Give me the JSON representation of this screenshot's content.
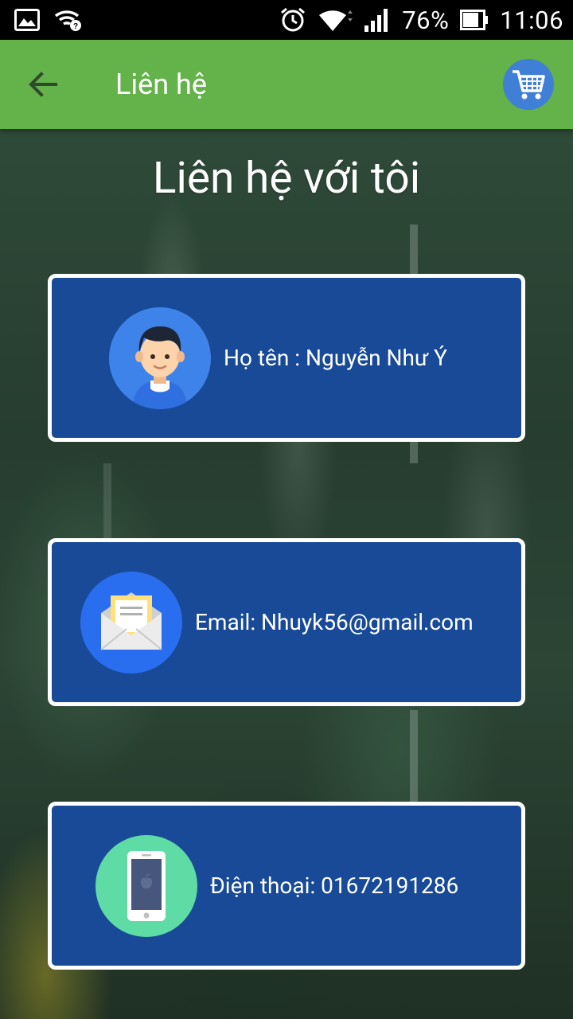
{
  "status_bar": {
    "battery": "76%",
    "time": "11:06"
  },
  "app_bar": {
    "title": "Liên hệ"
  },
  "main": {
    "heading": "Liên hệ với tôi",
    "cards": [
      {
        "icon": "person-avatar-icon",
        "text": "Họ tên : Nguyễn Như Ý"
      },
      {
        "icon": "envelope-icon",
        "text": "Email: Nhuyk56@gmail.com"
      },
      {
        "icon": "smartphone-icon",
        "text": "Điện thoại: 01672191286"
      }
    ]
  },
  "colors": {
    "app_bar": "#64b24a",
    "card": "#184a97",
    "cart_button": "#3f7fd6"
  }
}
